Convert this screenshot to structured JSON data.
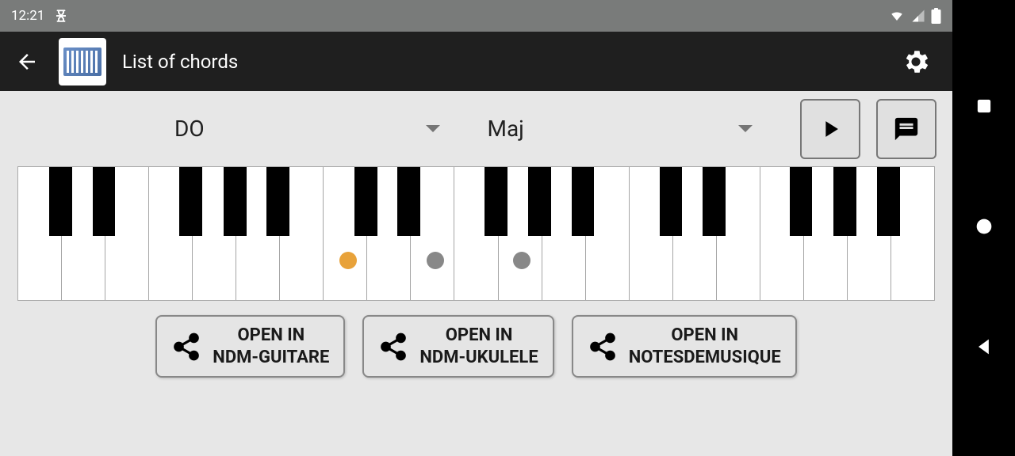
{
  "status": {
    "time": "12:21",
    "wifi": true,
    "signal": true,
    "battery": true
  },
  "appbar": {
    "title": "List of chords"
  },
  "controls": {
    "root_note": "DO",
    "chord_type": "Maj"
  },
  "keyboard": {
    "white_count": 21,
    "black_positions_pct": [
      3.4,
      8.1,
      17.6,
      22.4,
      27.1,
      36.7,
      41.4,
      50.9,
      55.7,
      60.4,
      70.0,
      74.7,
      84.2,
      89.0,
      93.8
    ],
    "dots": [
      {
        "pos_pct": 36.0,
        "type": "root"
      },
      {
        "pos_pct": 45.5,
        "type": "other"
      },
      {
        "pos_pct": 55.0,
        "type": "other"
      }
    ]
  },
  "share_buttons": [
    {
      "line1": "OPEN IN",
      "line2": "NDM-GUITARE"
    },
    {
      "line1": "OPEN IN",
      "line2": "NDM-UKULELE"
    },
    {
      "line1": "OPEN IN",
      "line2": "NOTESDEMUSIQUE"
    }
  ]
}
